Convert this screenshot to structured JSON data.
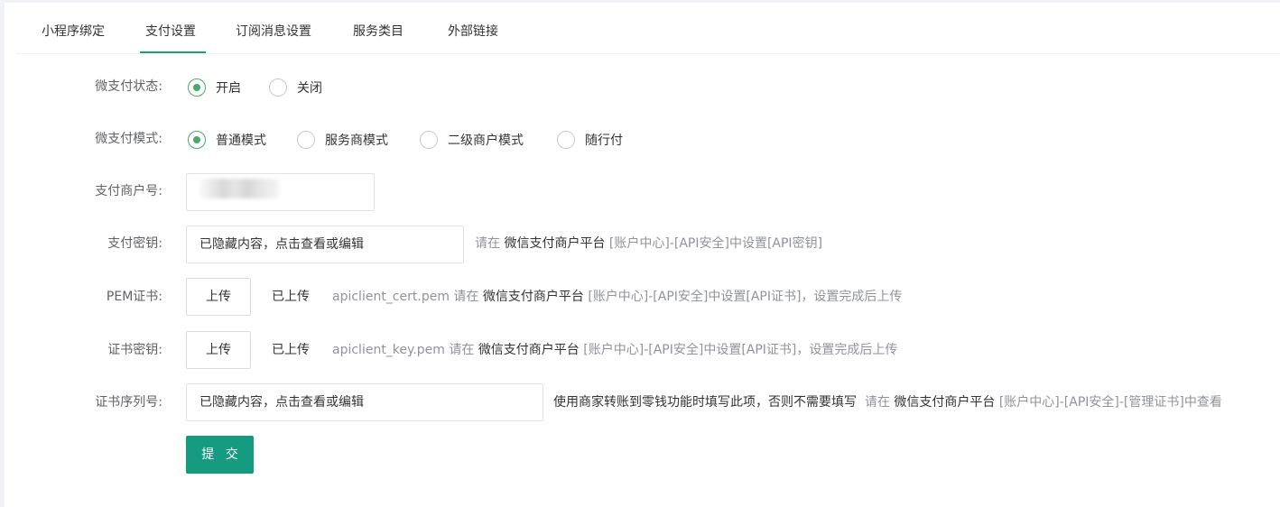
{
  "tabs": [
    {
      "label": "小程序绑定"
    },
    {
      "label": "支付设置"
    },
    {
      "label": "订阅消息设置"
    },
    {
      "label": "服务类目"
    },
    {
      "label": "外部链接"
    }
  ],
  "active_tab": "支付设置",
  "form": {
    "pay_status": {
      "label": "微支付状态:",
      "options": [
        "开启",
        "关闭"
      ],
      "selected": "开启"
    },
    "pay_mode": {
      "label": "微支付模式:",
      "options": [
        "普通模式",
        "服务商模式",
        "二级商户模式",
        "随行付"
      ],
      "selected": "普通模式"
    },
    "merchant_id": {
      "label": "支付商户号:"
    },
    "pay_key": {
      "label": "支付密钥:",
      "value": "已隐藏内容，点击查看或编辑",
      "hint_prefix": "请在",
      "hint_link": "微信支付商户平台",
      "hint_suffix": "[账户中心]-[API安全]中设置[API密钥]"
    },
    "pem_cert": {
      "label": "PEM证书:",
      "upload_label": "上传",
      "status": "已上传",
      "hint_prefix": "apiclient_cert.pem 请在",
      "hint_link": "微信支付商户平台",
      "hint_suffix": "[账户中心]-[API安全]中设置[API证书]，设置完成后上传"
    },
    "cert_key": {
      "label": "证书密钥:",
      "upload_label": "上传",
      "status": "已上传",
      "hint_prefix": "apiclient_key.pem 请在",
      "hint_link": "微信支付商户平台",
      "hint_suffix": "[账户中心]-[API安全]中设置[API证书]，设置完成后上传"
    },
    "cert_serial": {
      "label": "证书序列号:",
      "value": "已隐藏内容，点击查看或编辑",
      "note": "使用商家转账到零钱功能时填写此项，否则不需要填写",
      "hint_prefix": "请在",
      "hint_link": "微信支付商户平台",
      "hint_suffix": "[账户中心]-[API安全]-[管理证书]中查看"
    },
    "submit_label": "提 交"
  },
  "colors": {
    "accent": "#159b80",
    "radio_checked": "#4aa86b",
    "tab_underline": "#1f9e77",
    "hint_gray": "#909399"
  }
}
